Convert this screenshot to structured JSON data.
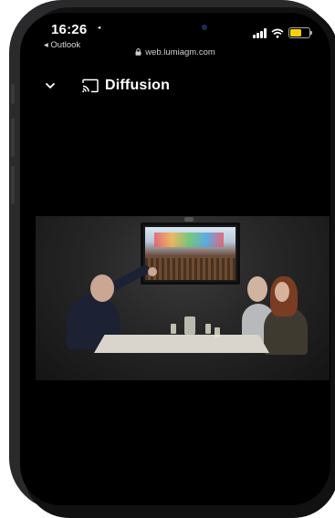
{
  "status_bar": {
    "time": "16:26",
    "back_app": "◂ Outlook",
    "battery_color": "#f5d10a"
  },
  "browser": {
    "url": "web.lumiagm.com"
  },
  "app_header": {
    "title": "Diffusion",
    "icons": [
      "chevron-down-icon",
      "cast-icon"
    ]
  },
  "video": {
    "description_icon": "video-stream"
  }
}
